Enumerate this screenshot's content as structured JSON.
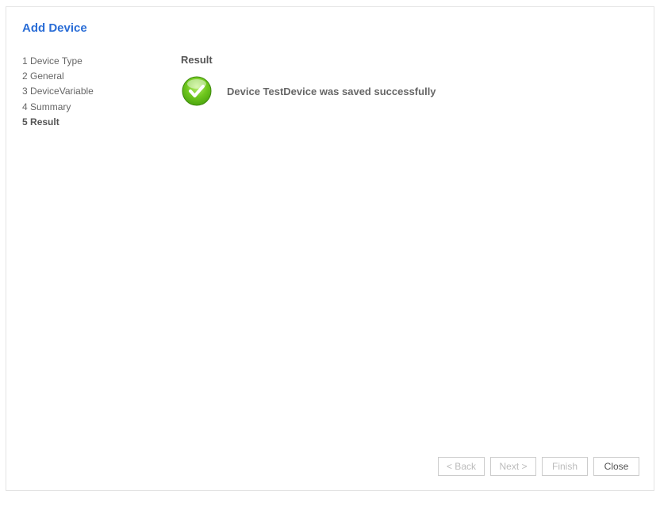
{
  "title": "Add Device",
  "sidebar": {
    "items": [
      {
        "n": "1",
        "label": "Device Type"
      },
      {
        "n": "2",
        "label": "General"
      },
      {
        "n": "3",
        "label": "DeviceVariable"
      },
      {
        "n": "4",
        "label": "Summary"
      },
      {
        "n": "5",
        "label": "Result"
      }
    ],
    "activeIndex": 4
  },
  "main": {
    "header": "Result",
    "message": "Device TestDevice was saved successfully"
  },
  "buttons": {
    "back": "< Back",
    "next": "Next >",
    "finish": "Finish",
    "close": "Close"
  }
}
